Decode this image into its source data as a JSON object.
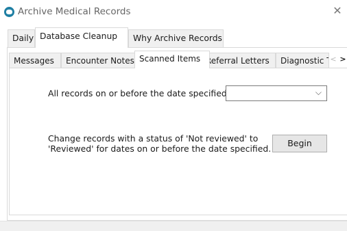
{
  "window": {
    "title": "Archive Medical Records",
    "close_symbol": "✕",
    "app_icon": "app-logo-icon"
  },
  "top_tabs": [
    {
      "label": "Daily",
      "active": false
    },
    {
      "label": "Database Cleanup",
      "active": true
    },
    {
      "label": "Why Archive Records",
      "active": false
    }
  ],
  "sub_tabs": [
    {
      "label": "Messages",
      "active": false
    },
    {
      "label": "Encounter Notes",
      "active": false
    },
    {
      "label": "Scanned Items",
      "active": true
    },
    {
      "label": "Referral Letters",
      "active": false
    },
    {
      "label": "Diagnostic Te",
      "active": false
    }
  ],
  "tab_scroll": {
    "left_symbol": "<",
    "right_symbol": ">"
  },
  "scanned_items": {
    "date_label": "All records on or before the date specified:",
    "date_value": "",
    "dropdown_symbol": "⌵",
    "change_text_line1": "Change records with a status of 'Not reviewed' to",
    "change_text_line2": "'Reviewed' for dates on or before the date specified.",
    "begin_label": "Begin"
  }
}
